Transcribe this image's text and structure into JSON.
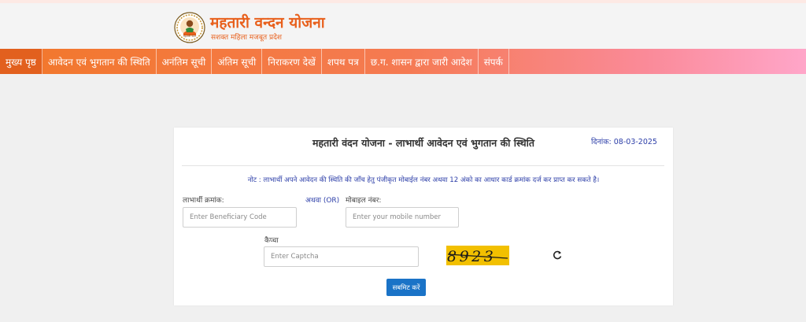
{
  "header": {
    "title": "महतारी वन्दन योजना",
    "subtitle": "सशक्त महिला मजबूत प्रदेश",
    "logo_text": "महतारी वंदन"
  },
  "nav": {
    "items": [
      {
        "label": "मुख्य पृष्ठ",
        "active": true
      },
      {
        "label": "आवेदन एवं भुगतान की स्थिति"
      },
      {
        "label": "अनंतिम सूची"
      },
      {
        "label": "अंतिम सूची"
      },
      {
        "label": "निराकरण देखें"
      },
      {
        "label": "शपथ पत्र"
      },
      {
        "label": "छ.ग. शासन द्वारा जारी आदेश"
      },
      {
        "label": "संपर्क"
      }
    ]
  },
  "form": {
    "title": "महतारी वंदन योजना - लाभार्थी आवेदन एवं भुगतान की स्थिति",
    "date": "दिनांक: 08-03-2025",
    "note": "नोट : लाभार्थी अपने आवेदन की स्थिति की जाँच हेतु पंजीकृत मोबाईल नंबर अथवा 12 अंको का आधार कार्ड क्रमांक दर्ज कर प्राप्त कर सकते है।",
    "beneficiary_label": "लाभार्थी क्रमांक:",
    "beneficiary_placeholder": "Enter Beneficiary Code",
    "or_label": "अथवा (OR)",
    "mobile_label": "मोबाइल नंबर:",
    "mobile_placeholder": "Enter your mobile number",
    "captcha_label": "कैप्चा",
    "captcha_placeholder": "Enter Captcha",
    "captcha_value": "8923",
    "submit_label": "सबमिट करें"
  },
  "colors": {
    "brand_orange": "#e8601c",
    "link_blue": "#2c3ea8",
    "button_blue": "#1a73c7",
    "captcha_yellow": "#f2c000"
  },
  "icons": {
    "logo": "mahtari-vandan-logo-icon",
    "refresh": "refresh-icon"
  }
}
